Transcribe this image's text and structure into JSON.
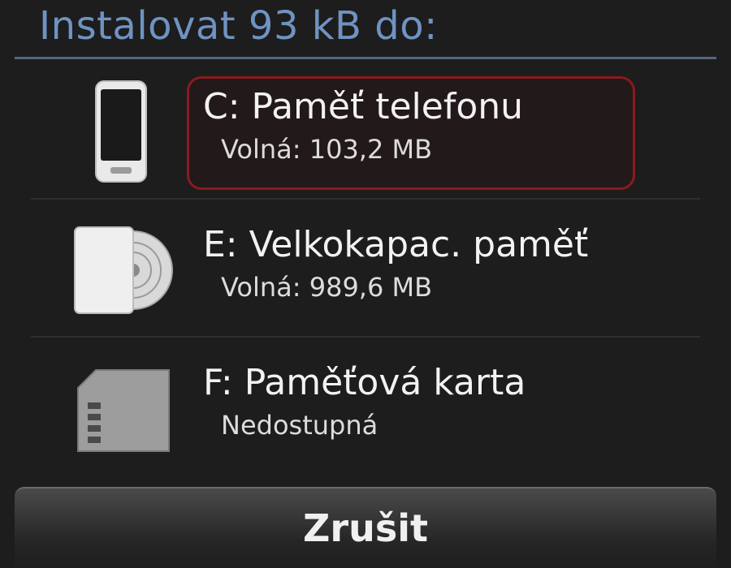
{
  "dialog": {
    "title": "Instalovat 93 kB do:",
    "options": [
      {
        "name": "C: Paměť telefonu",
        "status": "Volná: 103,2 MB",
        "icon": "phone-icon",
        "selected": true
      },
      {
        "name": "E: Velkokapac. paměť",
        "status": "Volná: 989,6 MB",
        "icon": "mass-storage-icon",
        "selected": false
      },
      {
        "name": "F: Paměťová karta",
        "status": "Nedostupná",
        "icon": "memory-card-icon",
        "selected": false
      }
    ],
    "cancel_label": "Zrušit"
  },
  "colors": {
    "title": "#6f93c2",
    "highlight_border": "#8a1a1f",
    "background": "#1d1d1d"
  }
}
